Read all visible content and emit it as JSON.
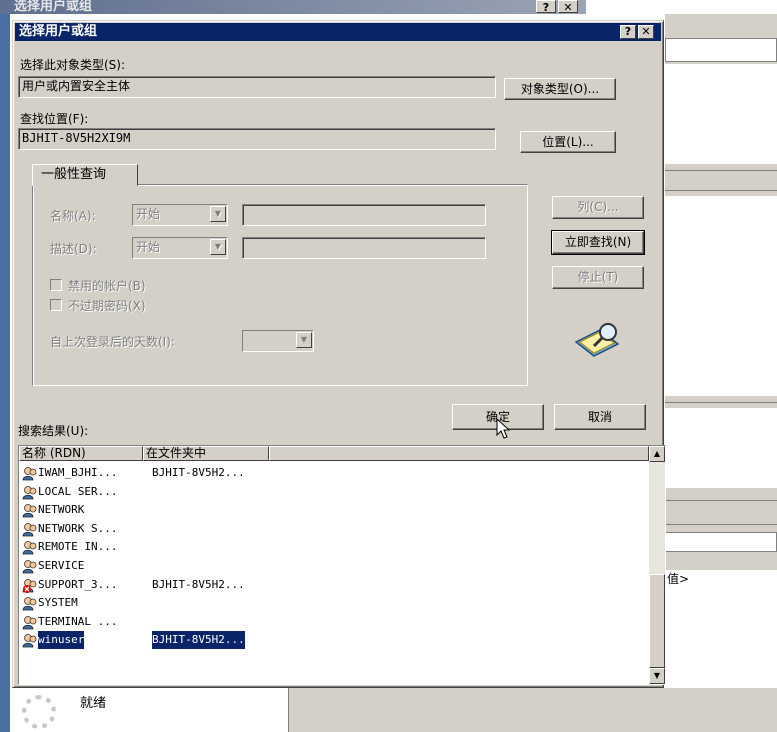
{
  "background_window": {
    "title": "选择用户或组",
    "help_btn": "?",
    "close_btn": "✕",
    "right_text": "值>",
    "status": "就绪"
  },
  "dialog": {
    "title": "选择用户或组",
    "help_btn": "?",
    "close_btn": "✕",
    "object_type_label": "选择此对象类型(S):",
    "object_type_value": "用户或内置安全主体",
    "object_type_button": "对象类型(O)...",
    "location_label": "查找位置(F):",
    "location_value": "BJHIT-8V5H2XI9M",
    "location_button": "位置(L)...",
    "tab_general": "一般性查询",
    "name_label": "名称(A):",
    "name_combo": "开始",
    "desc_label": "描述(D):",
    "desc_combo": "开始",
    "disabled_accounts": "禁用的帐户(B)",
    "non_expiring_pw": "不过期密码(X)",
    "days_since_login": "自上次登录后的天数(I):",
    "columns_button": "列(C)...",
    "find_now_button": "立即查找(N)",
    "stop_button": "停止(T)",
    "results_label": "搜索结果(U):",
    "ok_button": "确定",
    "cancel_button": "取消"
  },
  "results": {
    "columns": [
      "名称 (RDN)",
      "在文件夹中"
    ],
    "rows": [
      {
        "name": "IWAM_BJHI...",
        "folder": "BJHIT-8V5H2..."
      },
      {
        "name": "LOCAL SER...",
        "folder": ""
      },
      {
        "name": "NETWORK",
        "folder": ""
      },
      {
        "name": "NETWORK S...",
        "folder": ""
      },
      {
        "name": "REMOTE IN...",
        "folder": ""
      },
      {
        "name": "SERVICE",
        "folder": ""
      },
      {
        "name": "SUPPORT_3...",
        "folder": "BJHIT-8V5H2..."
      },
      {
        "name": "SYSTEM",
        "folder": ""
      },
      {
        "name": "TERMINAL ...",
        "folder": ""
      },
      {
        "name": "winuser",
        "folder": "BJHIT-8V5H2..."
      }
    ],
    "selected_index": 9
  },
  "colors": {
    "title_active": "#0a246a",
    "face": "#d4d0c8",
    "selection": "#0a246a"
  }
}
